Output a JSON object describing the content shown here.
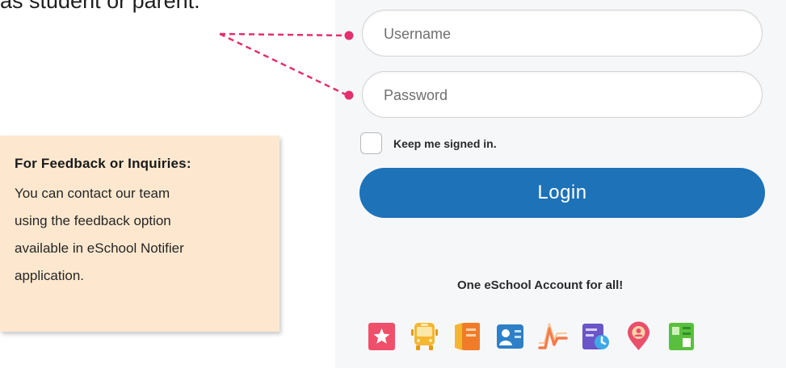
{
  "intro": {
    "text": "as student or parent."
  },
  "login_form": {
    "username_placeholder": "Username",
    "password_placeholder": "Password",
    "remember_label": "Keep me signed in.",
    "login_button_label": "Login"
  },
  "footer": {
    "tagline": "One eSchool Account for all!",
    "app_icons": [
      {
        "name": "star-bookmark-icon",
        "color": "#ef4f6a"
      },
      {
        "name": "school-bus-icon",
        "color": "#f5b731"
      },
      {
        "name": "notebook-icon",
        "color": "#f28a2c"
      },
      {
        "name": "profile-card-icon",
        "color": "#2d7fc7"
      },
      {
        "name": "health-wave-icon",
        "color": "#f47a4a"
      },
      {
        "name": "schedule-clock-icon",
        "color": "#6a55c9"
      },
      {
        "name": "location-pin-icon",
        "color": "#ea4f6c"
      },
      {
        "name": "report-book-icon",
        "color": "#5abf3e"
      }
    ]
  },
  "feedback": {
    "title": "For Feedback or Inquiries:",
    "lines": [
      "You can contact our team",
      "using the feedback option",
      "available in eSchool Notifier",
      "application."
    ]
  },
  "colors": {
    "accent": "#1d72b8",
    "connector": "#e3306f",
    "feedback_bg": "#fde8cf"
  }
}
